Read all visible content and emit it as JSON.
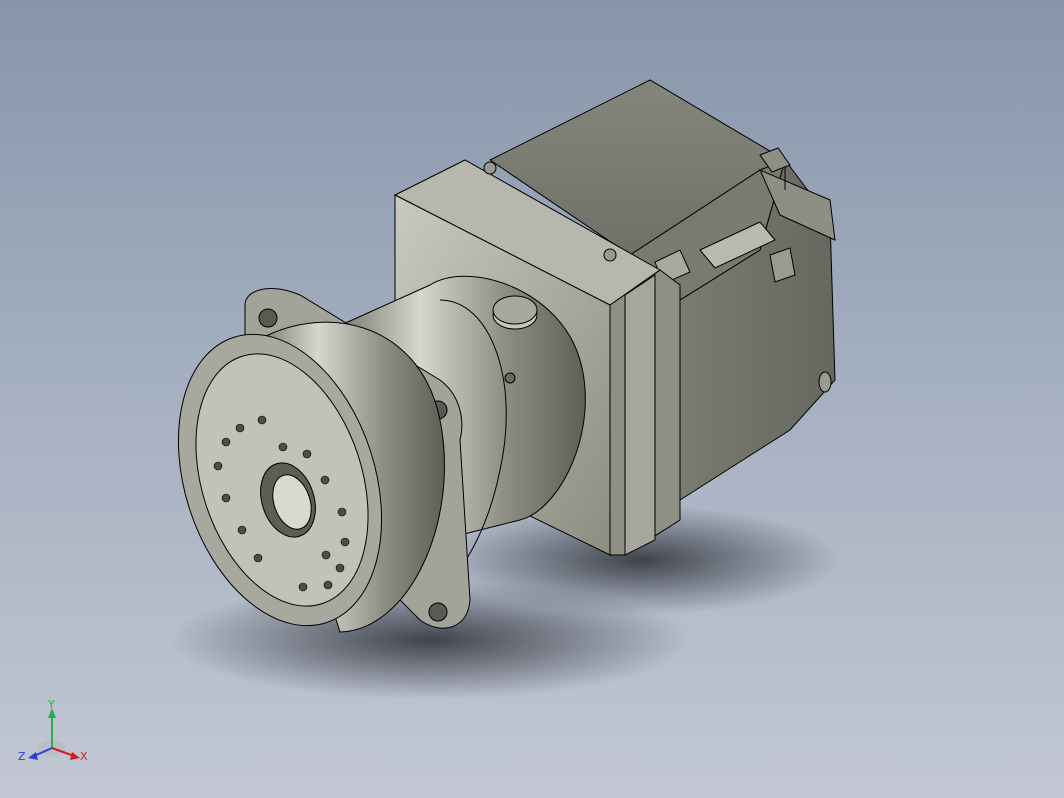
{
  "viewport": {
    "background_top": "#8796ab",
    "background_bottom": "#c2c7d3"
  },
  "model": {
    "part_color": "#8a8a7e",
    "flange_color": "#a3a39a",
    "motor_color": "#7f8076",
    "edge_color": "#000000"
  },
  "triad": {
    "x_label": "X",
    "y_label": "Y",
    "z_label": "Z",
    "x_color": "#d21e1e",
    "y_color": "#22b24c",
    "z_color": "#2a3fd6"
  }
}
